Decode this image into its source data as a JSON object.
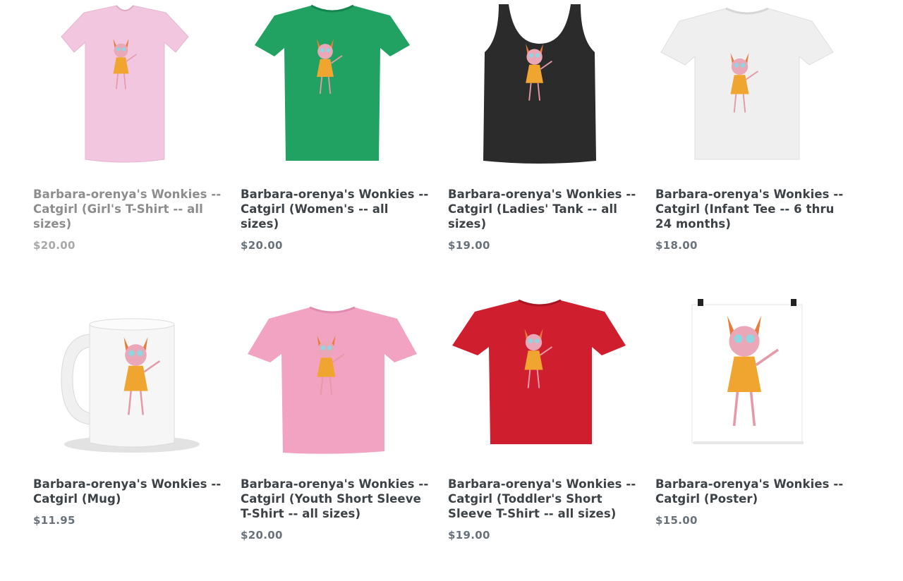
{
  "products": [
    {
      "title": "Barbara-orenya's Wonkies -- Catgirl (Girl's T-Shirt -- all sizes)",
      "price": "$20.00",
      "color": "#f1c6de",
      "kind": "girl-tee"
    },
    {
      "title": "Barbara-orenya's Wonkies -- Catgirl (Women's -- all sizes)",
      "price": "$20.00",
      "color": "#21a262",
      "kind": "women-tee"
    },
    {
      "title": "Barbara-orenya's Wonkies -- Catgirl (Ladies' Tank -- all sizes)",
      "price": "$19.00",
      "color": "#2b2b2b",
      "kind": "tank"
    },
    {
      "title": "Barbara-orenya's Wonkies -- Catgirl (Infant Tee -- 6 thru 24 months)",
      "price": "$18.00",
      "color": "#efefef",
      "kind": "infant-tee"
    },
    {
      "title": "Barbara-orenya's Wonkies -- Catgirl (Mug)",
      "price": "$11.95",
      "color": "#f4f4f4",
      "kind": "mug"
    },
    {
      "title": "Barbara-orenya's Wonkies -- Catgirl (Youth Short Sleeve T-Shirt -- all sizes)",
      "price": "$20.00",
      "color": "#f2a3c2",
      "kind": "youth-tee"
    },
    {
      "title": "Barbara-orenya's Wonkies -- Catgirl (Toddler's Short Sleeve T-Shirt -- all sizes)",
      "price": "$19.00",
      "color": "#cf1f2e",
      "kind": "toddler-tee"
    },
    {
      "title": "Barbara-orenya's Wonkies -- Catgirl (Poster)",
      "price": "$15.00",
      "color": "#ffffff",
      "kind": "poster"
    }
  ]
}
